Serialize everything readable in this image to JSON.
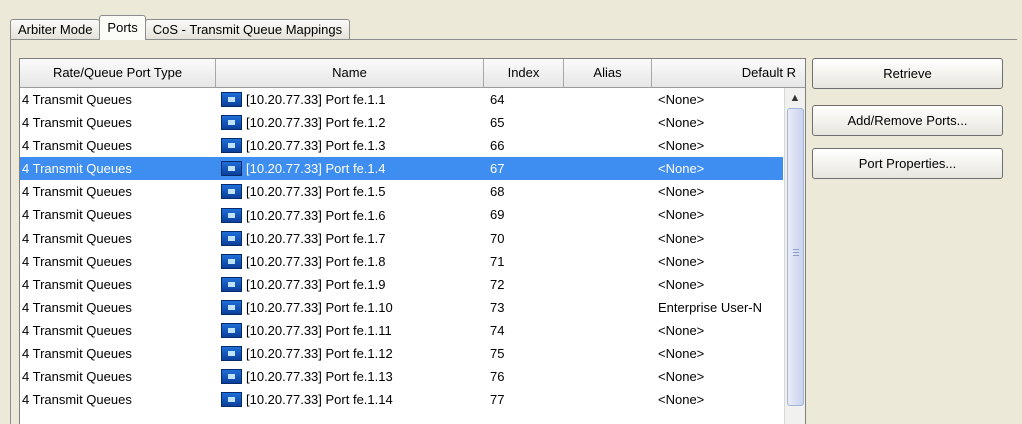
{
  "tabs": [
    "Arbiter Mode",
    "Ports",
    "CoS - Transmit Queue Mappings"
  ],
  "table": {
    "columns": [
      "Rate/Queue Port Type",
      "Name",
      "Index",
      "Alias",
      "Default R"
    ],
    "rows": [
      {
        "type": "4 Transmit Queues",
        "name": "[10.20.77.33] Port fe.1.1",
        "index": "64",
        "alias": "",
        "default": "<None>"
      },
      {
        "type": "4 Transmit Queues",
        "name": "[10.20.77.33] Port fe.1.2",
        "index": "65",
        "alias": "",
        "default": "<None>"
      },
      {
        "type": "4 Transmit Queues",
        "name": "[10.20.77.33] Port fe.1.3",
        "index": "66",
        "alias": "",
        "default": "<None>"
      },
      {
        "type": "4 Transmit Queues",
        "name": "[10.20.77.33] Port fe.1.4",
        "index": "67",
        "alias": "",
        "default": "<None>",
        "selected": true
      },
      {
        "type": "4 Transmit Queues",
        "name": "[10.20.77.33] Port fe.1.5",
        "index": "68",
        "alias": "",
        "default": "<None>"
      },
      {
        "type": "4 Transmit Queues",
        "name": "[10.20.77.33] Port fe.1.6",
        "index": "69",
        "alias": "",
        "default": "<None>"
      },
      {
        "type": "4 Transmit Queues",
        "name": "[10.20.77.33] Port fe.1.7",
        "index": "70",
        "alias": "",
        "default": "<None>"
      },
      {
        "type": "4 Transmit Queues",
        "name": "[10.20.77.33] Port fe.1.8",
        "index": "71",
        "alias": "",
        "default": "<None>"
      },
      {
        "type": "4 Transmit Queues",
        "name": "[10.20.77.33] Port fe.1.9",
        "index": "72",
        "alias": "",
        "default": "<None>"
      },
      {
        "type": "4 Transmit Queues",
        "name": "[10.20.77.33] Port fe.1.10",
        "index": "73",
        "alias": "",
        "default": "Enterprise User-N"
      },
      {
        "type": "4 Transmit Queues",
        "name": "[10.20.77.33] Port fe.1.11",
        "index": "74",
        "alias": "",
        "default": "<None>"
      },
      {
        "type": "4 Transmit Queues",
        "name": "[10.20.77.33] Port fe.1.12",
        "index": "75",
        "alias": "",
        "default": "<None>"
      },
      {
        "type": "4 Transmit Queues",
        "name": "[10.20.77.33] Port fe.1.13",
        "index": "76",
        "alias": "",
        "default": "<None>"
      },
      {
        "type": "4 Transmit Queues",
        "name": "[10.20.77.33] Port fe.1.14",
        "index": "77",
        "alias": "",
        "default": "<None>"
      }
    ]
  },
  "buttons": {
    "retrieve": "Retrieve",
    "add_remove": "Add/Remove Ports...",
    "port_properties": "Port Properties..."
  },
  "icons": {
    "port": "port-icon",
    "scroll_up": "chevron-up-icon"
  },
  "colors": {
    "selection": "#3d8ef0",
    "port_icon": "#1f6ed8"
  }
}
